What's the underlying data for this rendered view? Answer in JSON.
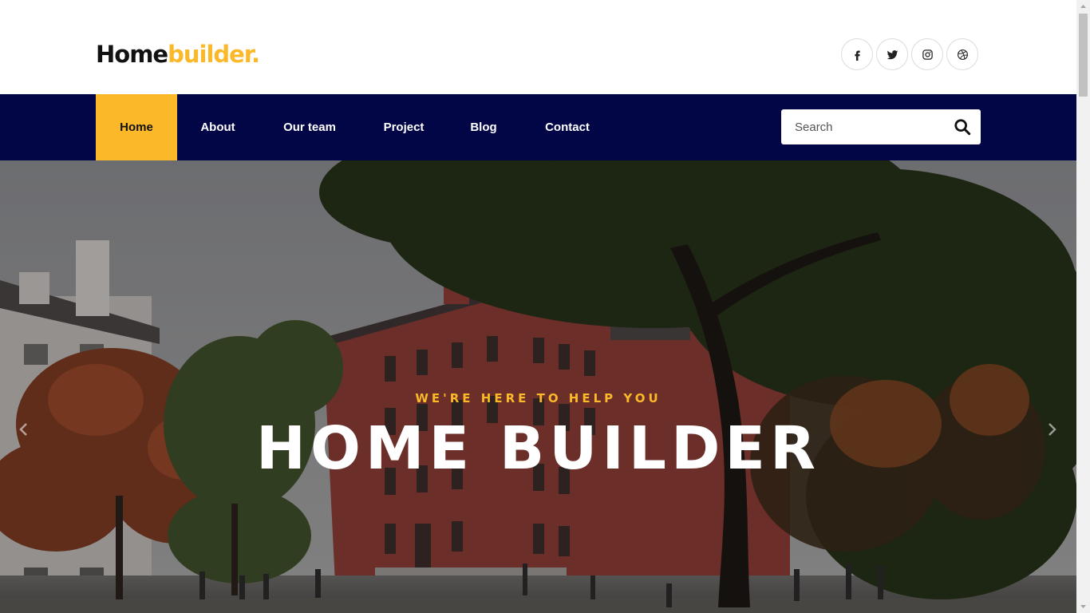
{
  "brand": {
    "part1": "Home",
    "part2": "builder."
  },
  "social": [
    {
      "name": "facebook-icon",
      "glyph": "f"
    },
    {
      "name": "twitter-icon"
    },
    {
      "name": "instagram-icon"
    },
    {
      "name": "dribbble-icon"
    }
  ],
  "nav": {
    "items": [
      {
        "label": "Home",
        "active": true
      },
      {
        "label": "About"
      },
      {
        "label": "Our team"
      },
      {
        "label": "Project"
      },
      {
        "label": "Blog"
      },
      {
        "label": "Contact"
      }
    ]
  },
  "search": {
    "placeholder": "Search",
    "value": ""
  },
  "hero": {
    "subtitle": "WE'RE HERE TO HELP YOU",
    "title": "HOME BUILDER"
  },
  "colors": {
    "accent": "#fbb929",
    "nav_bg": "#020546",
    "text_dark": "#111111"
  }
}
